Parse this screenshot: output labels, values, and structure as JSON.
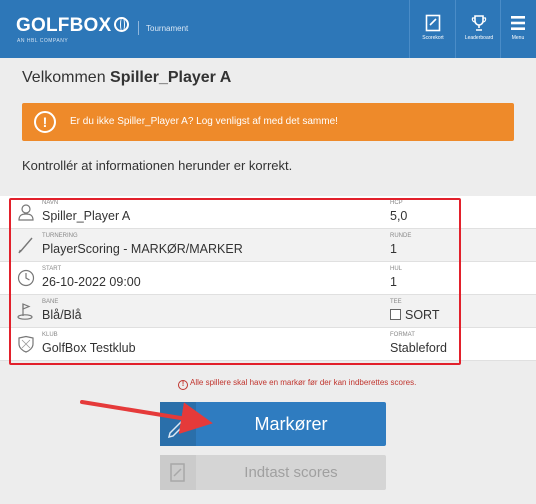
{
  "header": {
    "logo": "GOLFBOX",
    "logo_sub": "AN HBL COMPANY",
    "tagline": "Tournament",
    "scorecard_label": "Scorekort",
    "leaderboard_label": "Leaderboard",
    "menu_label": "Menu"
  },
  "welcome": {
    "prefix": "Velkommen",
    "name": "Spiller_Player A"
  },
  "warning": {
    "icon": "!",
    "text": "Er du ikke Spiller_Player A? Log venligst af med det samme!"
  },
  "check_text": "Kontrollér at informationen herunder er korrekt.",
  "info": {
    "rows": [
      {
        "icon": "person-icon",
        "k1": "NAVN",
        "v1": "Spiller_Player A",
        "k2": "HCP",
        "v2": "5,0"
      },
      {
        "icon": "pencil-icon",
        "k1": "TURNERING",
        "v1": "PlayerScoring - MARKØR/MARKER",
        "k2": "RUNDE",
        "v2": "1"
      },
      {
        "icon": "clock-icon",
        "k1": "START",
        "v1": "26-10-2022 09:00",
        "k2": "HUL",
        "v2": "1"
      },
      {
        "icon": "flag-icon",
        "k1": "BANE",
        "v1": "Blå/Blå",
        "k2": "TEE",
        "v2": "SORT"
      },
      {
        "icon": "shield-icon",
        "k1": "KLUB",
        "v1": "GolfBox Testklub",
        "k2": "FORMAT",
        "v2": "Stableford"
      }
    ]
  },
  "alert": {
    "icon": "!",
    "text": "Alle spillere skal have en markør før der kan indberettes scores."
  },
  "buttons": {
    "markers": "Markører",
    "enter_scores": "Indtast scores"
  },
  "colors": {
    "header": "#2d77b8",
    "warning": "#ee8a2a",
    "primary_button": "#2f7cc0",
    "highlight": "#e2202b"
  }
}
